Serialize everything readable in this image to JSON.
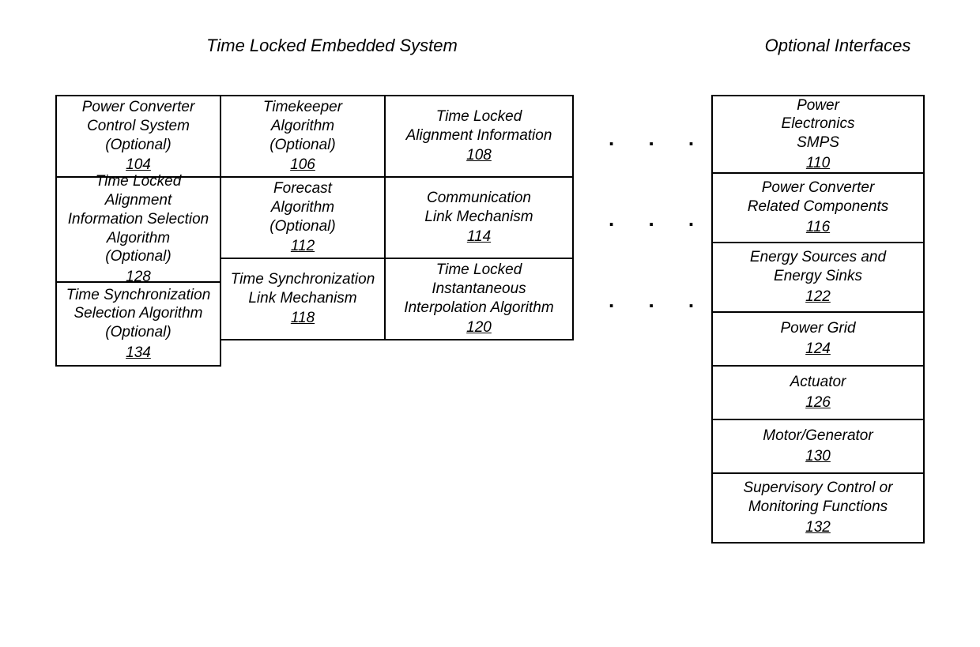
{
  "headings": {
    "left": "Time Locked Embedded System",
    "right": "Optional Interfaces"
  },
  "left": {
    "b104": {
      "lines": [
        "Power Converter",
        "Control System",
        "(Optional)"
      ],
      "ref": "104"
    },
    "b106": {
      "lines": [
        "Timekeeper",
        "Algorithm",
        "(Optional)"
      ],
      "ref": "106"
    },
    "b108": {
      "lines": [
        "Time Locked",
        "Alignment Information"
      ],
      "ref": "108"
    },
    "b128": {
      "lines": [
        "Time Locked Alignment",
        "Information Selection",
        "Algorithm",
        "(Optional)"
      ],
      "ref": "128"
    },
    "b112": {
      "lines": [
        "Forecast",
        "Algorithm",
        "(Optional)"
      ],
      "ref": "112"
    },
    "b114": {
      "lines": [
        "Communication",
        "Link Mechanism"
      ],
      "ref": "114"
    },
    "b118": {
      "lines": [
        "Time Synchronization",
        "Link Mechanism"
      ],
      "ref": "118"
    },
    "b120": {
      "lines": [
        "Time Locked",
        "Instantaneous",
        "Interpolation Algorithm"
      ],
      "ref": "120"
    },
    "b134": {
      "lines": [
        "Time Synchronization",
        "Selection Algorithm",
        "(Optional)"
      ],
      "ref": "134"
    }
  },
  "right": {
    "b110": {
      "lines": [
        "Power",
        "Electronics",
        "SMPS"
      ],
      "ref": "110"
    },
    "b116": {
      "lines": [
        "Power Converter",
        "Related Components"
      ],
      "ref": "116"
    },
    "b122": {
      "lines": [
        "Energy Sources and",
        "Energy Sinks"
      ],
      "ref": "122"
    },
    "b124": {
      "lines": [
        "Power Grid"
      ],
      "ref": "124"
    },
    "b126": {
      "lines": [
        "Actuator"
      ],
      "ref": "126"
    },
    "b130": {
      "lines": [
        "Motor/Generator"
      ],
      "ref": "130"
    },
    "b132": {
      "lines": [
        "Supervisory Control or",
        "Monitoring Functions"
      ],
      "ref": "132"
    }
  },
  "dots": ". . ."
}
